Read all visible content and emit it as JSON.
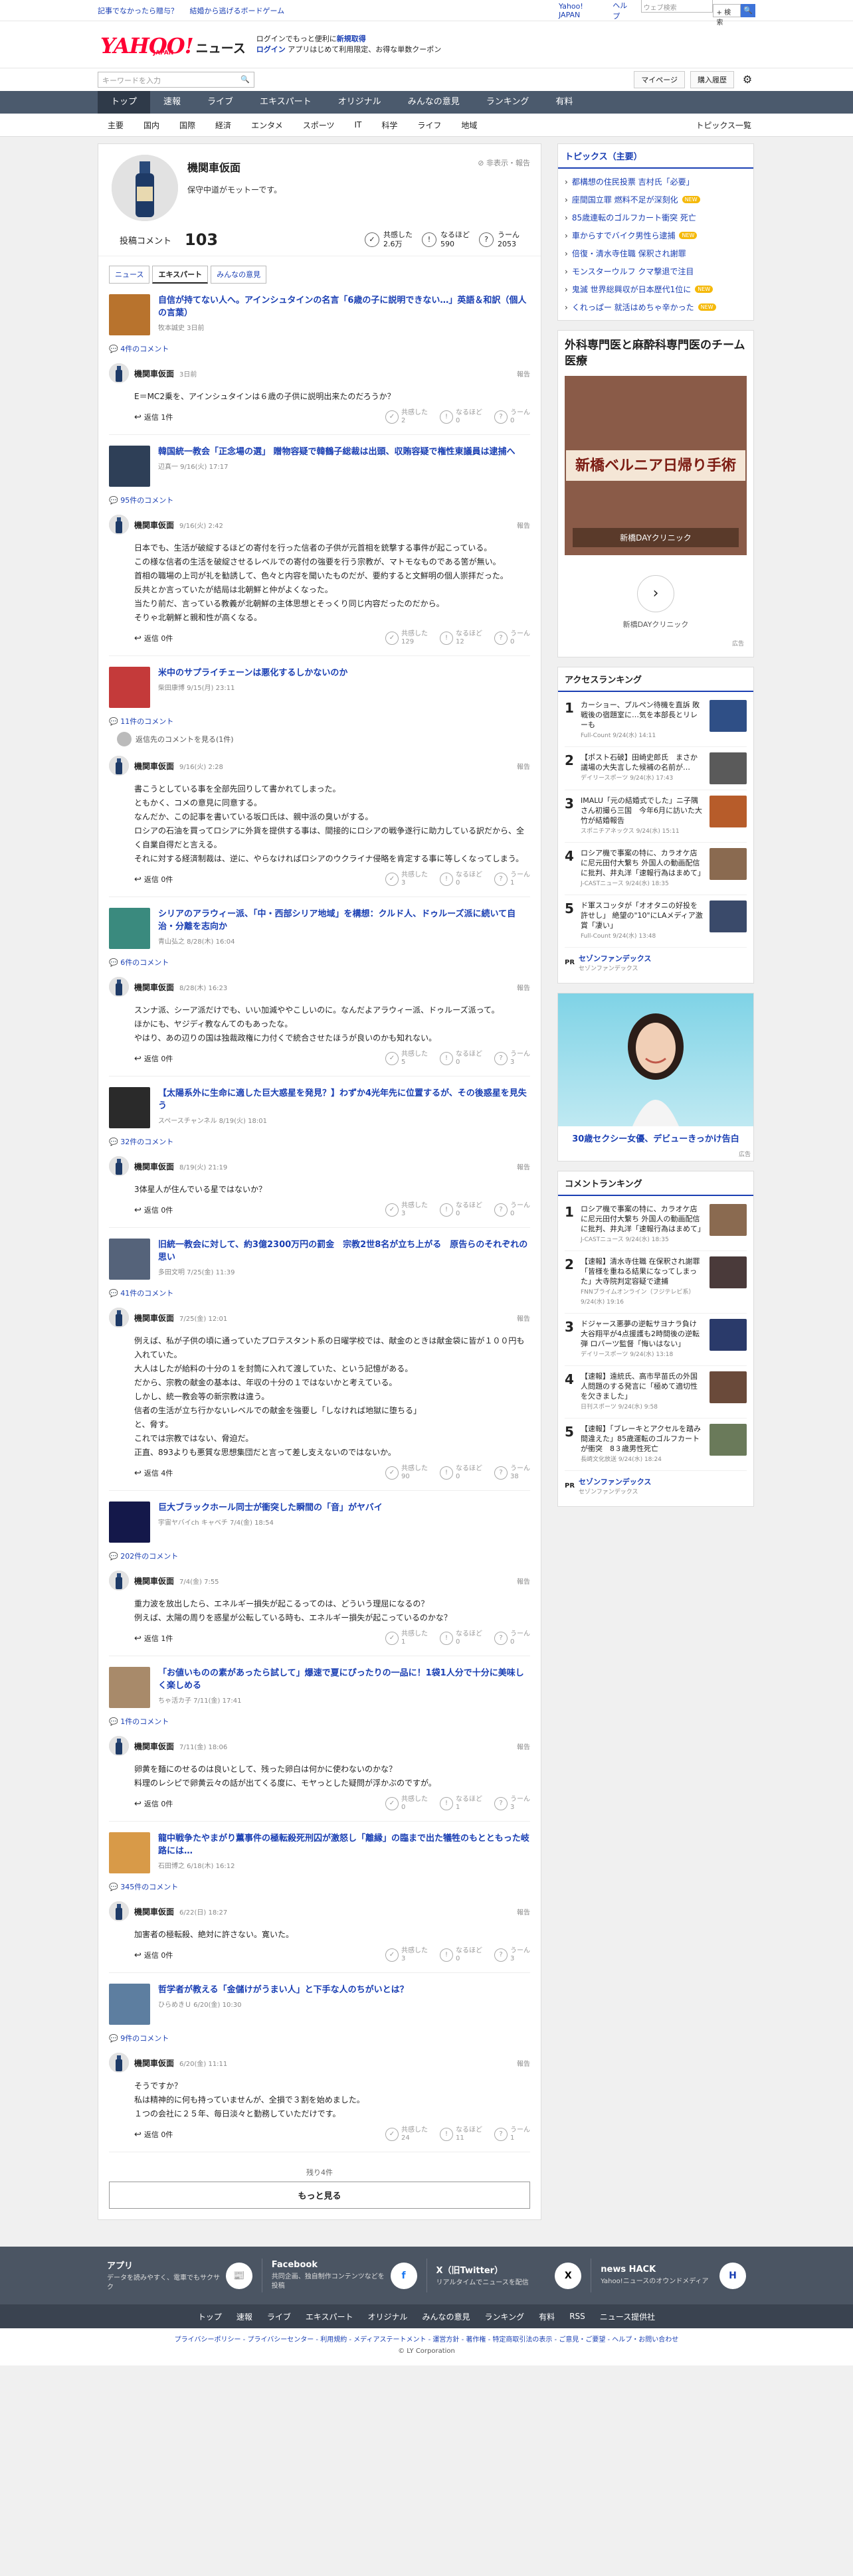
{
  "topbar": {
    "links": [
      "記事でなかったら贈与？",
      "結婚から逃げるボードゲーム"
    ],
    "yahoo_japan": "Yahoo! JAPAN",
    "help": "ヘルプ",
    "search_placeholder": "ウェブ検索",
    "search_button": "+ 検索",
    "go": "🔍"
  },
  "header": {
    "logo": "YAHOO!",
    "logo_sub": "JAPAN",
    "logo_news": "ニュース",
    "promo_line1_a": "ログインでもっと便利に",
    "promo_line1_b": "新規取得",
    "promo_line2_login": "ログイン",
    "promo_line2_rest": "アプリはじめて利用限定、お得な単数クーポン"
  },
  "search": {
    "placeholder": "キーワードを入力",
    "mypage": "マイページ",
    "history": "購入履歴",
    "gear": "⚙"
  },
  "nav": [
    "トップ",
    "速報",
    "ライブ",
    "エキスパート",
    "オリジナル",
    "みんなの意見",
    "ランキング",
    "有料"
  ],
  "categories": [
    "主要",
    "国内",
    "国際",
    "経済",
    "エンタメ",
    "スポーツ",
    "IT",
    "科学",
    "ライフ",
    "地域"
  ],
  "categories_last": "トピックス一覧",
  "profile": {
    "name": "機関車仮面",
    "bio": "保守中道がモットーです。",
    "flag": "非表示・報告",
    "comment_label": "投稿コメント",
    "comment_count": "103",
    "reacts": [
      {
        "icon": "✓",
        "label": "共感した",
        "value": "2.6万"
      },
      {
        "icon": "!",
        "label": "なるほど",
        "value": "590"
      },
      {
        "icon": "?",
        "label": "うーん",
        "value": "2053"
      }
    ]
  },
  "tabs": [
    "ニュース",
    "エキスパート",
    "みんなの意見"
  ],
  "entries": [
    {
      "title": "自信が持てない人へ。アインシュタインの名言「6歳の子に説明できない…」英語＆和訳（個人の言葉）",
      "meta": "牧本誠史 3日前",
      "ccount": "4件のコメント",
      "date": "3日前",
      "body": "E＝MC2乗を、アインシュタインは６歳の子供に説明出来たのだろうか？",
      "replies": "返信 1件",
      "r": [
        "2",
        "0",
        "0"
      ],
      "thumb": "#b8732d"
    },
    {
      "title": "韓国統一教会「正念場の選」 贈物容疑で韓鶴子総裁は出頭、収賄容疑で権性東議員は逮捕へ",
      "meta": "辺真一 9/16(火) 17:17",
      "ccount": "95件のコメント",
      "date": "9/16(火) 2:42",
      "body": "日本でも、生活が破綻するほどの寄付を行った信者の子供が元首相を銃撃する事件が起こっている。\nこの様な信者の生活を破綻させるレベルでの寄付の強要を行う宗教が、マトモなものである筈が無い。\n首相の職場の上司が礼を勧誘して、色々と内容を聞いたものだが、要約すると文鮮明の個人崇拝だった。\n反共とか言っていたが結局は北朝鮮と仲がよくなった。\n当たり前だ、言っている教義が北朝鮮の主体思想とそっくり同じ内容だったのだから。\nそりゃ北朝鮮と親和性が高くなる。",
      "replies": "返信 0件",
      "r": [
        "129",
        "12",
        "0"
      ],
      "thumb": "#2e3f57"
    },
    {
      "title": "米中のサプライチェーンは悪化するしかないのか",
      "meta": "柴田康博 9/15(月) 23:11",
      "ccount": "11件のコメント",
      "date": "9/16(火) 2:28",
      "body": "書こうとしている事を全部先回りして書かれてしまった。\nともかく、コメの意見に同意する。\nなんだか、この記事を書いている坂口氏は、親中派の臭いがする。\nロシアの石油を買ってロシアに外貨を提供する事は、間接的にロシアの戦争遂行に助力している訳だから、全く自業自得だと言える。\nそれに対する経済制裁は、逆に、やらなければロシアのウクライナ侵略を肯定する事に等しくなってしまう。",
      "replies": "返信 0件",
      "r": [
        "3",
        "0",
        "1"
      ],
      "thumb": "#c43a3a",
      "reply_note": "返信先のコメントを見る(1件)"
    },
    {
      "title": "シリアのアラウィー派、「中・西部シリア地域」を構想：クルド人、ドゥルーズ派に続いて自治・分離を志向か",
      "meta": "青山弘之 8/28(木) 16:04",
      "ccount": "6件のコメント",
      "date": "8/28(木) 16:23",
      "body": "スンナ派、シーア派だけでも、いい加減ややこしいのに。なんだよアラウィー派、ドゥルーズ派って。\nほかにも、ヤジディ教なんてのもあったな。\nやはり、あの辺りの国は独裁政権に力付くで統合させたほうが良いのかも知れない。",
      "replies": "返信 0件",
      "r": [
        "5",
        "0",
        "3"
      ],
      "thumb": "#3a8a7e"
    },
    {
      "title": "【太陽系外に生命に適した巨大惑星を発見？】わずか4光年先に位置するが、その後惑星を見失う",
      "meta": "スペースチャンネル 8/19(火) 18:01",
      "ccount": "32件のコメント",
      "date": "8/19(火) 21:19",
      "body": "3体星人が住んでいる星ではないか？",
      "replies": "返信 0件",
      "r": [
        "3",
        "0",
        "0"
      ],
      "thumb": "#2a2a2a"
    },
    {
      "title": "旧統一教会に対して、約3億2300万円の罰金　宗教2世8名が立ち上がる　原告らのそれぞれの思い",
      "meta": "多田文明 7/25(金) 11:39",
      "ccount": "41件のコメント",
      "date": "7/25(金) 12:01",
      "body": "例えば、私が子供の頃に通っていたプロテスタント系の日曜学校では、献金のときは献金袋に皆が１００円も入れていた。\n大人はしたが給料の十分の１を封筒に入れて渡していた、という記憶がある。\nだから、宗教の献金の基本は、年収の十分の１ではないかと考えている。\nしかし、統一教会等の新宗教は違う。\n信者の生活が立ち行かないレベルでの献金を強要し「しなければ地獄に堕ちる」\nと、脅す。\nこれでは宗教ではない、脅迫だ。\n正直、893よりも悪質な思想集団だと言って差し支えないのではないか。",
      "replies": "返信 4件",
      "r": [
        "90",
        "0",
        "38"
      ],
      "thumb": "#55637a"
    },
    {
      "title": "巨大ブラックホール同士が衝突した瞬間の「音」がヤバイ",
      "meta": "宇宙ヤバイch キャベチ 7/4(金) 18:54",
      "ccount": "202件のコメント",
      "date": "7/4(金) 7:55",
      "body": "重力波を放出したら、エネルギー損失が起こるってのは、どういう理屈になるの？\n例えば、太陽の周りを惑星が公転している時も、エネルギー損失が起こっているのかな？",
      "replies": "返信 1件",
      "r": [
        "1",
        "0",
        "0"
      ],
      "thumb": "#14184a"
    },
    {
      "title": "「お値いものの素があったら試して」爆速で夏にぴったりの一品に！1袋1人分で十分に美味しく楽しめる",
      "meta": "ちゃ活カ子 7/11(金) 17:41",
      "ccount": "1件のコメント",
      "date": "7/11(金) 18:06",
      "body": "卵黄を麺にのせるのは良いとして、残った卵白は何かに使わないのかな？\n料理のレシピで卵黄云々の話が出てくる度に、モヤっとした疑問が浮かぶのですが。",
      "replies": "返信 0件",
      "r": [
        "0",
        "1",
        "3"
      ],
      "thumb": "#a88a6a"
    },
    {
      "title": "龍中戦争たやまがり薫事件の極転殺死刑囚が激怒し「離縁」の臨まで出た犠牲のもとともった岐路には…",
      "meta": "石田博之 6/18(木) 16:12",
      "ccount": "345件のコメント",
      "date": "6/22(日) 18:27",
      "body": "加害者の極転殺、絶対に許さない。寛いた。",
      "replies": "返信 0件",
      "r": [
        "3",
        "0",
        "3"
      ],
      "thumb": "#d89a48"
    },
    {
      "title": "哲学者が教える「金儲けがうまい人」と下手な人のちがいとは？",
      "meta": "ひらめきＵ 6/20(金) 10:30",
      "ccount": "9件のコメント",
      "date": "6/20(金) 11:11",
      "body": "そうですか？\n私は精神的に何も持っていませんが、全損で３割を始めました。\n１つの会社に２５年、毎日淡々と勤務していただけです。",
      "replies": "返信 0件",
      "r": [
        "24",
        "11",
        "1"
      ],
      "thumb": "#5d7ea0"
    }
  ],
  "reaction_labels": [
    "共感した",
    "なるほど",
    "うーん"
  ],
  "report": "報告",
  "more": {
    "remaining": "残り4件",
    "button": "もっと見る"
  },
  "topics": {
    "title": "トピックス（主要）",
    "items": [
      {
        "t": "都構想の住民投票 吉村氏「必要」",
        "b": ""
      },
      {
        "t": "座間国立罪 燃料不足が深刻化",
        "b": "NEW"
      },
      {
        "t": "85歳連転のゴルフカート衝突 死亡",
        "b": ""
      },
      {
        "t": "車からすでバイク男性ら逮捕",
        "b": "NEW"
      },
      {
        "t": "倍復・清水寺住職 保釈され謝罪",
        "b": ""
      },
      {
        "t": "モンスターウルフ クマ撃退で注目",
        "b": ""
      },
      {
        "t": "鬼滅 世界総興収が日本歴代1位に",
        "b": "NEW"
      },
      {
        "t": "くれっぱー 就活はめちゃ辛かった",
        "b": "NEW"
      }
    ]
  },
  "ad1": {
    "title": "外科専門医と麻酔科専門医のチーム医療",
    "img_big": "新橋ベルニア日帰り手術",
    "img_label": "新橋DAYクリニック",
    "sub": "新橋DAYクリニック",
    "tag": "広告"
  },
  "access": {
    "title": "アクセスランキング",
    "items": [
      {
        "t": "カーショー、プルペン待機を直訴 敗戦後の宿題室に…気を本部長とリレーも",
        "s": "Full-Count 9/24(水) 14:11",
        "c": "#2f4f86"
      },
      {
        "t": "【ポスト石破】田崎史郎氏　まさか議場の大失言した候補の名前が…",
        "s": "デイリースポーツ 9/24(水) 17:43",
        "c": "#5a5a5a"
      },
      {
        "t": "IMALU「元の結婚式でした」ニ子隅さん初撮ら三国　今年6月に訪いた大竹が結婚報告",
        "s": "スポニチアネックス 9/24(水) 15:11",
        "c": "#b75c2a"
      },
      {
        "t": "ロシア機で事案の特に、カラオケ店に尼元田付大繋ち 外国人の動画配信に批判、井丸洋「速報行為はまめて」",
        "s": "J-CASTニュース 9/24(水) 18:35",
        "c": "#8a6a50"
      },
      {
        "t": "ド軍スコッタが「オオタニの好投を許せし」 絶望の\"10\"にLAメディア激賞「凄い」",
        "s": "Full-Count 9/24(水) 13:48",
        "c": "#3a4a6a"
      }
    ],
    "pr": {
      "tag": "PR",
      "t": "セゾンファンデックス",
      "s": "セゾンファンデックス"
    }
  },
  "ad2": {
    "cap": "30歳セクシー女優、デビューきっかけ告白",
    "tag": "広告"
  },
  "comment_rank": {
    "title": "コメントランキング",
    "items": [
      {
        "t": "ロシア機で事案の特に、カラオケ店に尼元田付大繋ち 外国人の動画配信に批判、井丸洋「速報行為はまめて」",
        "s": "J-CASTニュース 9/24(水) 18:35",
        "c": "#8a6a50"
      },
      {
        "t": "【速報】清水寺住職 在保釈され謝罪「皆様を重ねる結果になってしまった」大寺院判定容疑で逮捕",
        "s": "FNNプライムオンライン（フジテレビ系） 9/24(水) 19:16",
        "c": "#4a3a3a"
      },
      {
        "t": "ドジャース悪夢の逆転サヨナラ負け　大谷翔平が4点援護も2時間後の逆転弾 ロバーツ監督「悔いはない」",
        "s": "デイリースポーツ 9/24(水) 13:18",
        "c": "#2a3a6a"
      },
      {
        "t": "【速報】遠統氏、高市早苗氏の外国人問題のする発言に「極めて適切性を欠きました」",
        "s": "日刊スポーツ 9/24(水) 9:58",
        "c": "#6a4a3a"
      },
      {
        "t": "【速報】「ブレーキとアクセルを踏み間違えた」85歳運転のゴルフカートが衝突　8３歳男性死亡",
        "s": "長崎文化放送 9/24(水) 18:24",
        "c": "#6a7a5a"
      }
    ],
    "pr": {
      "tag": "PR",
      "t": "セゾンファンデックス",
      "s": "セゾンファンデックス"
    }
  },
  "footer": {
    "apps": [
      {
        "n": "アプリ",
        "d": "データを読みやすく、電車でもサクサク",
        "i": "📰"
      },
      {
        "n": "Facebook",
        "d": "共同企画、独自制作コンテンツなどを投稿",
        "i": "f"
      },
      {
        "n": "X（旧Twitter）",
        "d": "リアルタイムでニュースを配信",
        "i": "X"
      },
      {
        "n": "news HACK",
        "d": "Yahoo!ニュースのオウンドメディア",
        "i": "H"
      }
    ],
    "nav": [
      "トップ",
      "速報",
      "ライブ",
      "エキスパート",
      "オリジナル",
      "みんなの意見",
      "ランキング",
      "有料",
      "RSS",
      "ニュース提供社"
    ],
    "links": "プライバシーポリシー - プライバシーセンター - 利用規約 - メディアステートメント - 運営方針 - 著作権 - 特定商取引法の表示 - ご意見・ご要望 - ヘルプ・お問い合わせ",
    "copyright": "© LY Corporation"
  }
}
